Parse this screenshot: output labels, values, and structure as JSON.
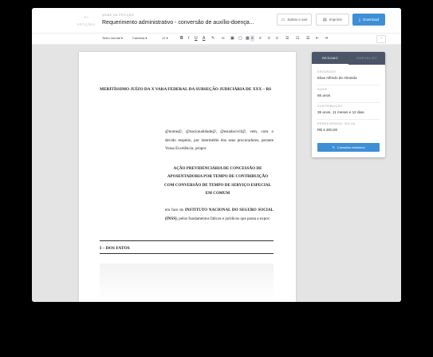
{
  "header": {
    "back_label": "PETIÇÕES",
    "kicker": "NOME DA PETIÇÃO",
    "title": "Requerimento administrativo - conversão de auxílio-doença...",
    "save_exit_label": "Salvar e sair",
    "print_label": "Imprimir",
    "download_label": "Download"
  },
  "toolbar": {
    "style_value": "Texto normal",
    "font_value": "Cambria",
    "size_value": "12"
  },
  "document": {
    "court_heading": "MERITÍSSIMO JUÍZO DA X VARA FEDERAL DA SUBSEÇÃO JUDICIÁRIA DE XXX – RS",
    "intro": "@nome@, @nacionalidade@, @estadocivil@, vem, com o devido respeito, por intermédio dos seus procuradores, perante Vossa Excelência, propor",
    "action_title": "AÇÃO PREVIDENCIÁRIA DE CONCESSÃO DE APOSENTADORIA POR TEMPO DE CONTRIBUIÇÃO COM CONVERSÃO DE TEMPO DE SERVIÇO ESPECIAL EM COMUM",
    "against_prefix": "em face do ",
    "against_entity": "INSTITUTO NACIONAL DO SEGURO SOCIAL (INSS)",
    "against_suffix": ", pelos fundamentos fáticos e jurídicos que passa a expor:",
    "section_title": "I – DOS FATOS"
  },
  "panel": {
    "tabs": [
      "RESUMO",
      "CHECKLIST"
    ],
    "active_tab": "RESUMO",
    "fields": [
      {
        "label": "SEGURADO",
        "value": "Elias Alfredo de Almeida"
      },
      {
        "label": "IDADE",
        "value": "66 anos"
      },
      {
        "label": "CONTRIBUIÇÃO",
        "value": "36 anos, 11 meses e 12 dias."
      },
      {
        "label": "RENDA MENSAL INICIAL",
        "value": "R$ 4.300,00"
      }
    ],
    "report_button_label": "Consultar relatórios"
  },
  "colors": {
    "accent": "#3d8fd6",
    "panel_header": "#4a5568",
    "workspace": "#e4e4e4"
  }
}
